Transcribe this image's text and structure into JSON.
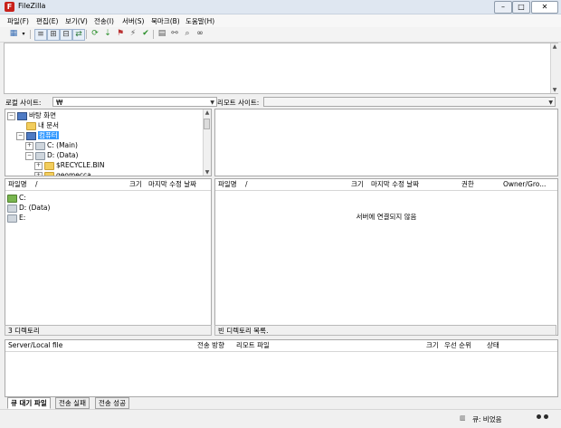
{
  "window": {
    "title": "FileZilla",
    "minimize": "–",
    "maximize": "□",
    "close": "✕",
    "app_icon_letter": "F"
  },
  "menu": [
    "파일(F)",
    "편집(E)",
    "보기(V)",
    "전송(I)",
    "서버(S)",
    "북마크(B)",
    "도움말(H)"
  ],
  "toolbar": {
    "icons": [
      "site-manager-icon",
      "dropdown-icon",
      "toggle-log-icon",
      "toggle-local-tree-icon",
      "toggle-remote-tree-icon",
      "toggle-queue-icon",
      "refresh-icon",
      "process-queue-icon",
      "cancel-icon",
      "disconnect-icon",
      "reconnect-icon",
      "dir-compare-icon",
      "sync-browse-icon",
      "search-icon",
      "binoculars-icon"
    ]
  },
  "local": {
    "site_label": "로컬 사이트:",
    "site_value": "₩",
    "tree": [
      {
        "label": "바탕 화면",
        "indent": 0,
        "exp": "−",
        "kind": "monitor"
      },
      {
        "label": "내 문서",
        "indent": 1,
        "exp": "",
        "kind": "folder"
      },
      {
        "label": "컴퓨터",
        "indent": 1,
        "exp": "−",
        "kind": "monitor",
        "selected": true
      },
      {
        "label": "C: (Main)",
        "indent": 2,
        "exp": "+",
        "kind": "drive"
      },
      {
        "label": "D: (Data)",
        "indent": 2,
        "exp": "−",
        "kind": "drive"
      },
      {
        "label": "$RECYCLE.BIN",
        "indent": 3,
        "exp": "+",
        "kind": "folder"
      },
      {
        "label": "geomecca",
        "indent": 3,
        "exp": "+",
        "kind": "folder"
      }
    ],
    "columns": [
      "파일명",
      "/",
      "크기",
      "마지막 수정 날짜"
    ],
    "files": [
      "C:",
      "D: (Data)",
      "E:"
    ],
    "status": "3 디렉토리"
  },
  "remote": {
    "site_label": "리모트 사이트:",
    "site_value": "",
    "columns": [
      "파일명",
      "/",
      "크기",
      "마지막 수정 날짜",
      "권한",
      "Owner/Gro..."
    ],
    "empty_message": "서버에 연결되지 않음",
    "status": "빈 디렉토리 목록."
  },
  "queue": {
    "columns": [
      "Server/Local file",
      "전송 방향",
      "리모트 파일",
      "크기",
      "우선 순위",
      "상태"
    ],
    "tabs": [
      "큐 대기 파일",
      "전송 실패",
      "전송 성공"
    ],
    "status": "큐: 비었음"
  }
}
